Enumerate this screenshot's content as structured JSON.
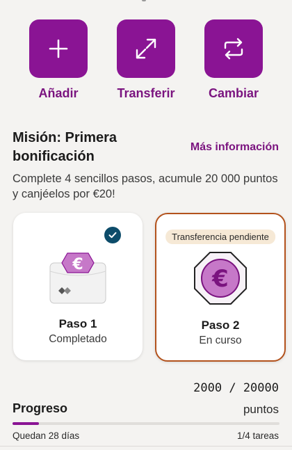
{
  "actions": [
    {
      "label": "Añadir",
      "icon": "plus-icon"
    },
    {
      "label": "Transferir",
      "icon": "transfer-icon"
    },
    {
      "label": "Cambiar",
      "icon": "exchange-icon"
    }
  ],
  "mission": {
    "title": "Misión: Primera bonificación",
    "more_link": "Más información",
    "description": "Complete 4 sencillos pasos, acumule 20 000 puntos y canjéelos por €20!"
  },
  "steps": [
    {
      "step": "Paso 1",
      "status": "Completado",
      "completed": true,
      "icon": "euro-envelope-icon"
    },
    {
      "step": "Paso 2",
      "status": "En curso",
      "badge": "Transferencia pendiente",
      "icon": "euro-coin-icon"
    }
  ],
  "progress": {
    "points": "2000 / 20000",
    "points_unit": "puntos",
    "label": "Progreso",
    "fraction": 0.1,
    "days_left": "Quedan 28 días",
    "tasks": "1/4 tareas"
  },
  "colors": {
    "brand": "#8a1494",
    "brand_text": "#7a137f",
    "check": "#0d4c6a",
    "active_border": "#b3521c"
  }
}
